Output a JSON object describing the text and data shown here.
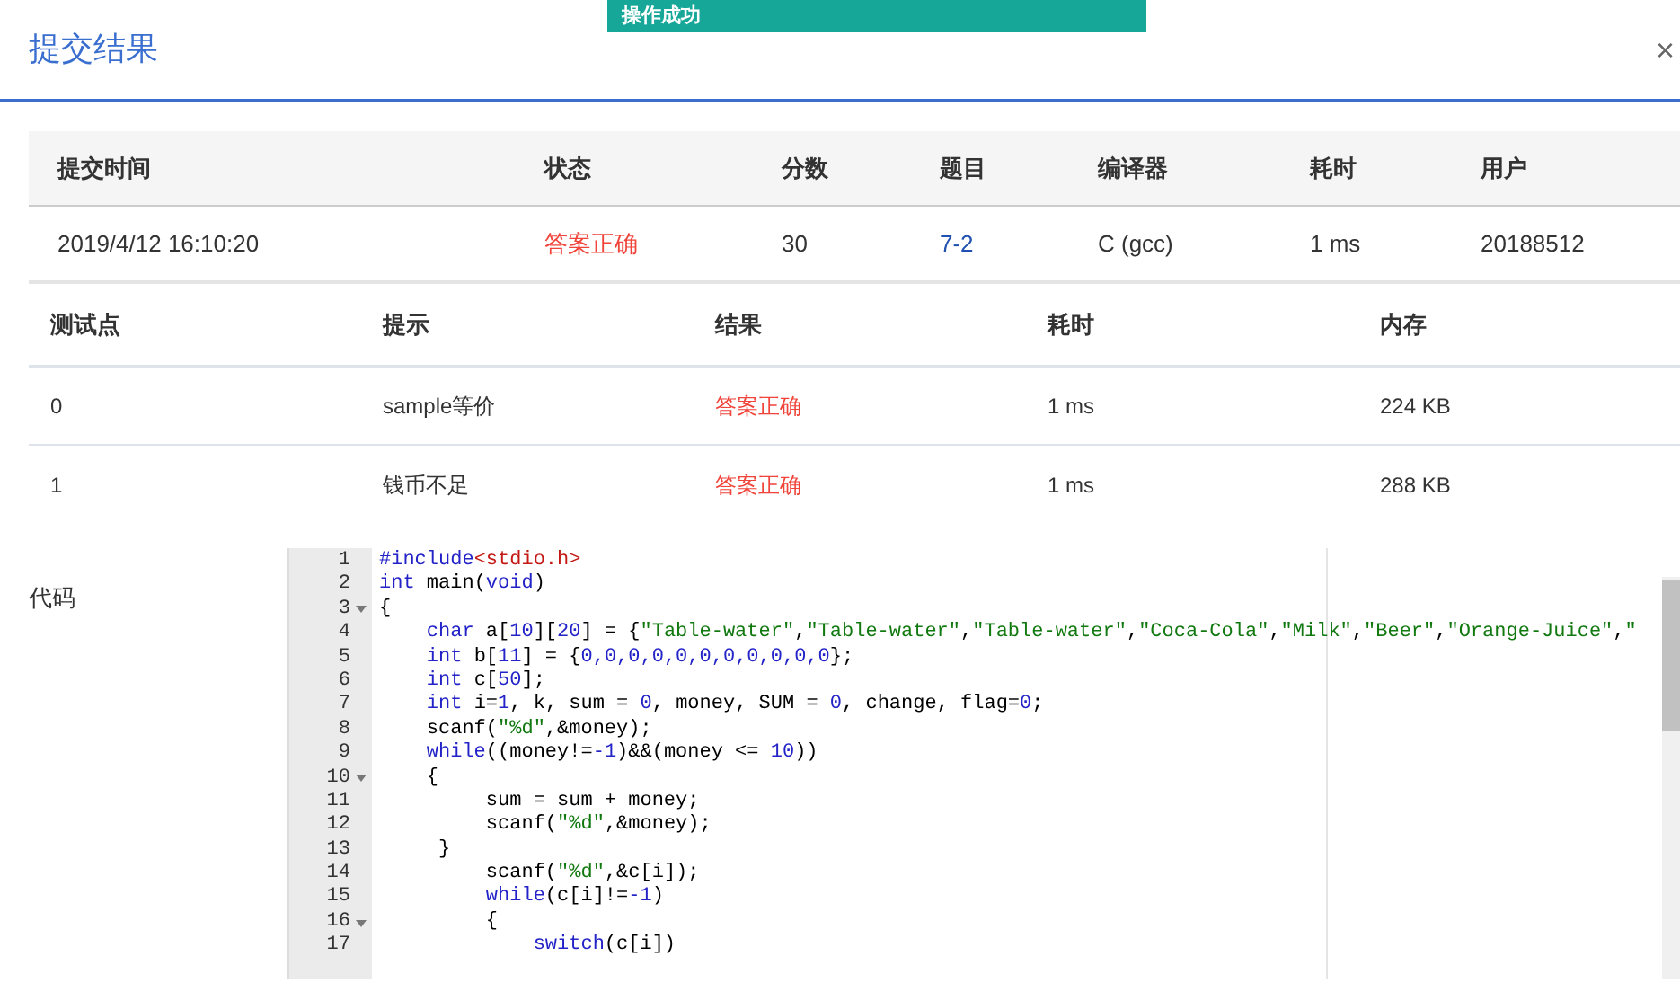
{
  "toast": {
    "text": "操作成功"
  },
  "dialog": {
    "title": "提交结果",
    "close": "×"
  },
  "submission": {
    "columns": [
      "提交时间",
      "状态",
      "分数",
      "题目",
      "编译器",
      "耗时",
      "用户"
    ],
    "row": [
      {
        "text": "2019/4/12 16:10:20",
        "kind": "plain"
      },
      {
        "text": "答案正确",
        "kind": "status"
      },
      {
        "text": "30",
        "kind": "plain"
      },
      {
        "text": "7-2",
        "kind": "link"
      },
      {
        "text": "C (gcc)",
        "kind": "plain"
      },
      {
        "text": "1 ms",
        "kind": "plain"
      },
      {
        "text": "20188512",
        "kind": "plain"
      }
    ]
  },
  "tests": {
    "columns": [
      "测试点",
      "提示",
      "结果",
      "耗时",
      "内存"
    ],
    "rows": [
      [
        {
          "text": "0",
          "kind": "plain"
        },
        {
          "text": "sample等价",
          "kind": "plain"
        },
        {
          "text": "答案正确",
          "kind": "status"
        },
        {
          "text": "1 ms",
          "kind": "plain"
        },
        {
          "text": "224 KB",
          "kind": "plain"
        }
      ],
      [
        {
          "text": "1",
          "kind": "plain"
        },
        {
          "text": "钱币不足",
          "kind": "plain"
        },
        {
          "text": "答案正确",
          "kind": "status"
        },
        {
          "text": "1 ms",
          "kind": "plain"
        },
        {
          "text": "288 KB",
          "kind": "plain"
        }
      ]
    ]
  },
  "code": {
    "label": "代码",
    "lines": [
      {
        "number": "1",
        "foldable": false,
        "tokens": [
          {
            "kind": "meta",
            "text": "#include"
          },
          {
            "kind": "header",
            "text": "<stdio.h>"
          }
        ]
      },
      {
        "number": "2",
        "foldable": false,
        "tokens": [
          {
            "kind": "keyword",
            "text": "int"
          },
          {
            "kind": "plain",
            "text": " main("
          },
          {
            "kind": "keyword",
            "text": "void"
          },
          {
            "kind": "plain",
            "text": ")"
          }
        ]
      },
      {
        "number": "3",
        "foldable": true,
        "tokens": [
          {
            "kind": "plain",
            "text": "{"
          }
        ]
      },
      {
        "number": "4",
        "foldable": false,
        "tokens": [
          {
            "kind": "keyword",
            "text": "    char"
          },
          {
            "kind": "plain",
            "text": " a["
          },
          {
            "kind": "number",
            "text": "10"
          },
          {
            "kind": "plain",
            "text": "]["
          },
          {
            "kind": "number",
            "text": "20"
          },
          {
            "kind": "plain",
            "text": "] = {"
          },
          {
            "kind": "string",
            "text": "\"Table-water\""
          },
          {
            "kind": "plain",
            "text": ","
          },
          {
            "kind": "string",
            "text": "\"Table-water\""
          },
          {
            "kind": "plain",
            "text": ","
          },
          {
            "kind": "string",
            "text": "\"Table-water\""
          },
          {
            "kind": "plain",
            "text": ","
          },
          {
            "kind": "string",
            "text": "\"Coca-Cola\""
          },
          {
            "kind": "plain",
            "text": ","
          },
          {
            "kind": "string",
            "text": "\"Milk\""
          },
          {
            "kind": "plain",
            "text": ","
          },
          {
            "kind": "string",
            "text": "\"Beer\""
          },
          {
            "kind": "plain",
            "text": ","
          },
          {
            "kind": "string",
            "text": "\"Orange-Juice\""
          },
          {
            "kind": "plain",
            "text": ","
          },
          {
            "kind": "string",
            "text": "\""
          }
        ]
      },
      {
        "number": "5",
        "foldable": false,
        "tokens": [
          {
            "kind": "keyword",
            "text": "    int"
          },
          {
            "kind": "plain",
            "text": " b["
          },
          {
            "kind": "number",
            "text": "11"
          },
          {
            "kind": "plain",
            "text": "] = {"
          },
          {
            "kind": "number",
            "text": "0,0,0,0,0,0,0,0,0,0,0"
          },
          {
            "kind": "plain",
            "text": "};"
          }
        ]
      },
      {
        "number": "6",
        "foldable": false,
        "tokens": [
          {
            "kind": "keyword",
            "text": "    int"
          },
          {
            "kind": "plain",
            "text": " c["
          },
          {
            "kind": "number",
            "text": "50"
          },
          {
            "kind": "plain",
            "text": "];"
          }
        ]
      },
      {
        "number": "7",
        "foldable": false,
        "tokens": [
          {
            "kind": "keyword",
            "text": "    int"
          },
          {
            "kind": "plain",
            "text": " i="
          },
          {
            "kind": "number",
            "text": "1"
          },
          {
            "kind": "plain",
            "text": ", k, sum = "
          },
          {
            "kind": "number",
            "text": "0"
          },
          {
            "kind": "plain",
            "text": ", money, SUM = "
          },
          {
            "kind": "number",
            "text": "0"
          },
          {
            "kind": "plain",
            "text": ", change, flag="
          },
          {
            "kind": "number",
            "text": "0"
          },
          {
            "kind": "plain",
            "text": ";"
          }
        ]
      },
      {
        "number": "8",
        "foldable": false,
        "tokens": [
          {
            "kind": "plain",
            "text": "    scanf("
          },
          {
            "kind": "string",
            "text": "\"%d\""
          },
          {
            "kind": "plain",
            "text": ",&money);"
          }
        ]
      },
      {
        "number": "9",
        "foldable": false,
        "tokens": [
          {
            "kind": "keyword",
            "text": "    while"
          },
          {
            "kind": "plain",
            "text": "((money!="
          },
          {
            "kind": "number",
            "text": "-1"
          },
          {
            "kind": "plain",
            "text": ")&&(money <= "
          },
          {
            "kind": "number",
            "text": "10"
          },
          {
            "kind": "plain",
            "text": "))"
          }
        ]
      },
      {
        "number": "10",
        "foldable": true,
        "tokens": [
          {
            "kind": "plain",
            "text": "    {"
          }
        ]
      },
      {
        "number": "11",
        "foldable": false,
        "tokens": [
          {
            "kind": "plain",
            "text": "         sum = sum + money;"
          }
        ]
      },
      {
        "number": "12",
        "foldable": false,
        "tokens": [
          {
            "kind": "plain",
            "text": "         scanf("
          },
          {
            "kind": "string",
            "text": "\"%d\""
          },
          {
            "kind": "plain",
            "text": ",&money);"
          }
        ]
      },
      {
        "number": "13",
        "foldable": false,
        "tokens": [
          {
            "kind": "plain",
            "text": "     }"
          }
        ]
      },
      {
        "number": "14",
        "foldable": false,
        "tokens": [
          {
            "kind": "plain",
            "text": "         scanf("
          },
          {
            "kind": "string",
            "text": "\"%d\""
          },
          {
            "kind": "plain",
            "text": ",&c[i]);"
          }
        ]
      },
      {
        "number": "15",
        "foldable": false,
        "tokens": [
          {
            "kind": "keyword",
            "text": "         while"
          },
          {
            "kind": "plain",
            "text": "(c[i]!="
          },
          {
            "kind": "number",
            "text": "-1"
          },
          {
            "kind": "plain",
            "text": ")"
          }
        ]
      },
      {
        "number": "16",
        "foldable": true,
        "tokens": [
          {
            "kind": "plain",
            "text": "         {"
          }
        ]
      },
      {
        "number": "17",
        "foldable": false,
        "tokens": [
          {
            "kind": "keyword",
            "text": "             switch"
          },
          {
            "kind": "plain",
            "text": "(c[i])"
          }
        ]
      }
    ]
  }
}
